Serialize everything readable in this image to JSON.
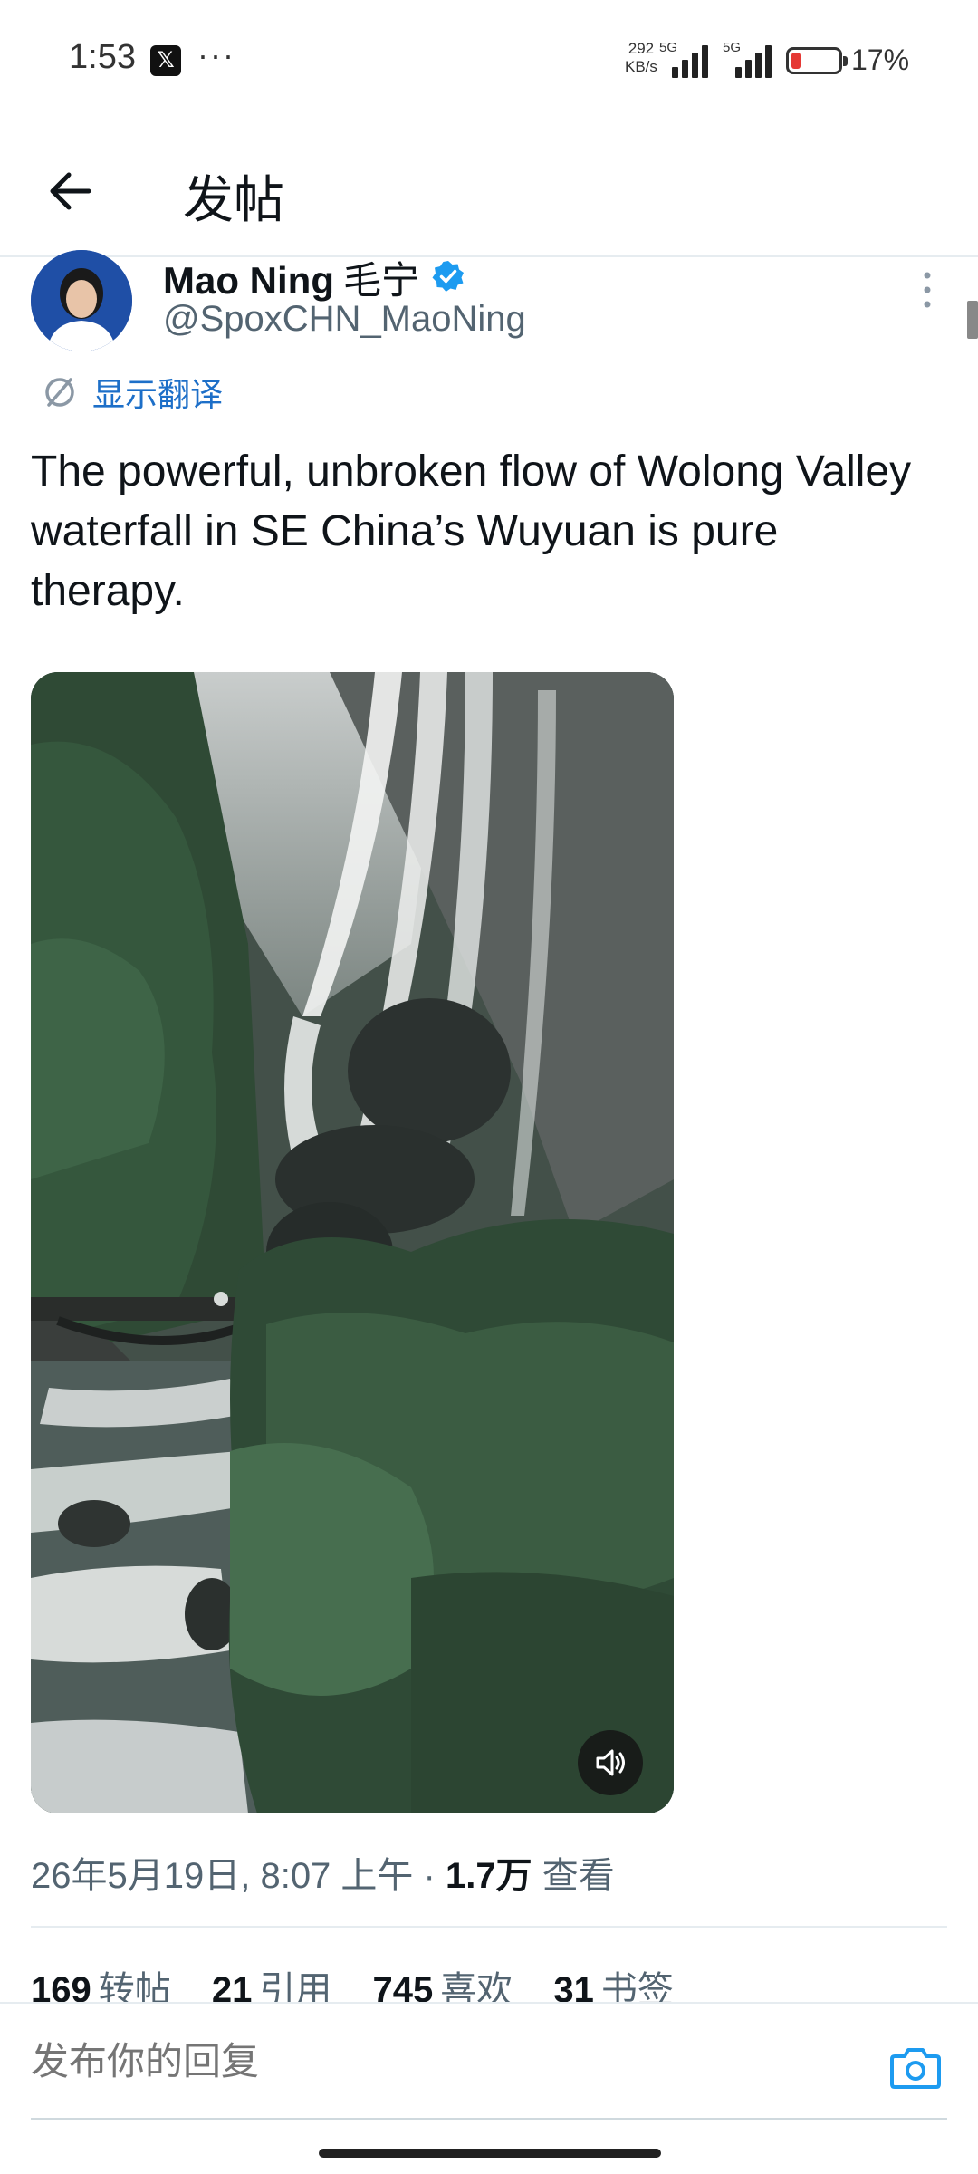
{
  "status_bar": {
    "time": "1:53",
    "notif_icon": "x-app-icon",
    "more_dots": "···",
    "net_speed": "292",
    "net_speed_unit": "KB/s",
    "net_type_1": "5G",
    "net_type_2": "5G",
    "battery_percent": "17%",
    "battery_color": "#e53935"
  },
  "header": {
    "back_icon": "back-arrow-icon",
    "title": "发帖"
  },
  "author": {
    "name": "Mao Ning",
    "name_cn": "毛宁",
    "handle": "@SpoxCHN_MaoNing",
    "verified_color": "#1d9bf0"
  },
  "translate": {
    "label": "显示翻译"
  },
  "tweet": {
    "text": "The powerful, unbroken flow of Wolong Valley waterfall in SE China’s Wuyuan is pure therapy.",
    "media_icon": "volume-icon"
  },
  "meta": {
    "datetime": "26年5月19日, 8:07 上午 · ",
    "views_count": "1.7万",
    "views_label": " 查看"
  },
  "stats": [
    {
      "count": "169",
      "label": "转帖"
    },
    {
      "count": "21",
      "label": "引用"
    },
    {
      "count": "745",
      "label": "喜欢"
    },
    {
      "count": "31",
      "label": "书签"
    }
  ],
  "reply": {
    "placeholder": "发布你的回复",
    "camera_icon": "camera-icon",
    "accent": "#1d9bf0"
  }
}
